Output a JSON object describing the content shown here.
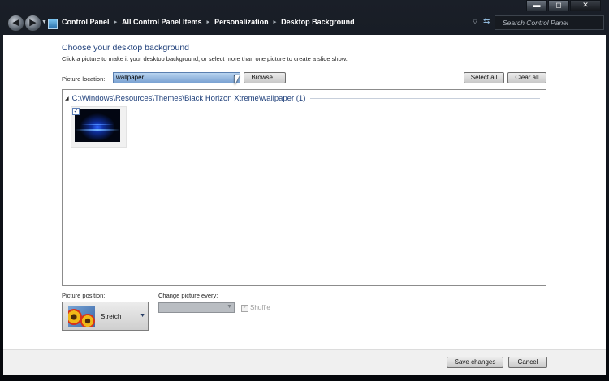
{
  "window": {
    "caption_buttons": {
      "minimize": "▬",
      "maximize": "◻",
      "close": "✕"
    }
  },
  "nav": {
    "back_icon": "back-arrow-icon",
    "forward_icon": "forward-arrow-icon",
    "breadcrumbs": [
      "Control Panel",
      "All Control Panel Items",
      "Personalization",
      "Desktop Background"
    ],
    "separator": "▸",
    "search_placeholder": "Search Control Panel"
  },
  "main": {
    "heading": "Choose your desktop background",
    "subtext": "Click a picture to make it your desktop background, or select more than one picture to create a slide show.",
    "picture_location_label": "Picture location:",
    "picture_location_value": "wallpaper",
    "browse_label": "Browse...",
    "select_all_label": "Select all",
    "clear_all_label": "Clear all",
    "group_title": "C:\\Windows\\Resources\\Themes\\Black Horizon Xtreme\\wallpaper (1)",
    "thumbnails": [
      {
        "checked": true,
        "check_mark": "✓"
      }
    ]
  },
  "footer_options": {
    "position_label": "Picture position:",
    "position_value": "Stretch",
    "change_label": "Change picture every:",
    "change_value": "",
    "shuffle_label": "Shuffle",
    "shuffle_checked": true,
    "shuffle_check_mark": "✓"
  },
  "bottom": {
    "save_label": "Save changes",
    "cancel_label": "Cancel"
  },
  "colors": {
    "heading": "#1e3f7a",
    "location_highlight": "#7aa2d2"
  }
}
